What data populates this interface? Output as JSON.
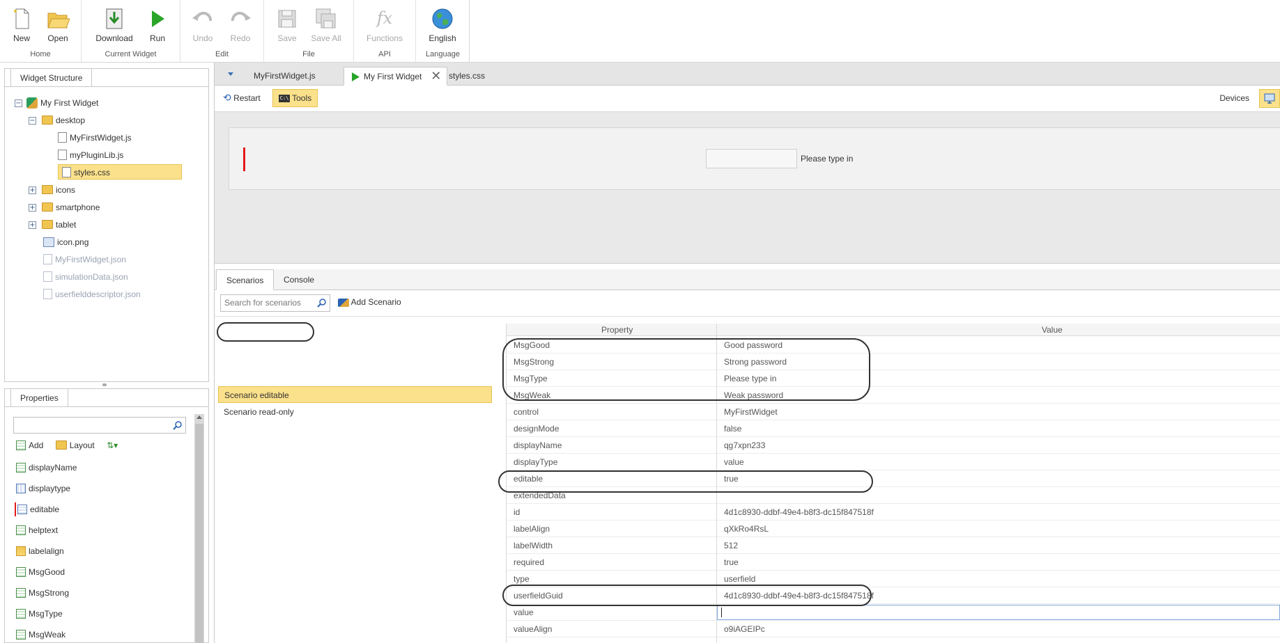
{
  "ribbon": {
    "groups": [
      {
        "name": "Home",
        "buttons": [
          {
            "label": "New"
          },
          {
            "label": "Open"
          }
        ]
      },
      {
        "name": "Current Widget",
        "buttons": [
          {
            "label": "Download"
          },
          {
            "label": "Run"
          }
        ]
      },
      {
        "name": "Edit",
        "buttons": [
          {
            "label": "Undo"
          },
          {
            "label": "Redo"
          }
        ]
      },
      {
        "name": "File",
        "buttons": [
          {
            "label": "Save"
          },
          {
            "label": "Save All"
          }
        ]
      },
      {
        "name": "API",
        "buttons": [
          {
            "label": "Functions"
          }
        ]
      },
      {
        "name": "Language",
        "buttons": [
          {
            "label": "English"
          }
        ]
      }
    ]
  },
  "widget_structure": {
    "tab": "Widget Structure",
    "tree": [
      {
        "label": "My First Widget"
      },
      {
        "label": "desktop"
      },
      {
        "label": "MyFirstWidget.js"
      },
      {
        "label": "myPluginLib.js"
      },
      {
        "label": "styles.css"
      },
      {
        "label": "icons"
      },
      {
        "label": "smartphone"
      },
      {
        "label": "tablet"
      },
      {
        "label": "icon.png"
      },
      {
        "label": "MyFirstWidget.json"
      },
      {
        "label": "simulationData.json"
      },
      {
        "label": "userfielddescriptor.json"
      }
    ]
  },
  "properties": {
    "tab": "Properties",
    "toolbar": {
      "add": "Add",
      "layout": "Layout"
    },
    "items": [
      "displayName",
      "displaytype",
      "editable",
      "helptext",
      "labelalign",
      "MsgGood",
      "MsgStrong",
      "MsgType",
      "MsgWeak"
    ]
  },
  "doc_tabs": {
    "tab1": "MyFirstWidget.js",
    "tab2": "My First Widget",
    "tab3": "styles.css"
  },
  "toolbar2": {
    "restart": "Restart",
    "tools": "Tools",
    "devices": "Devices"
  },
  "preview": {
    "hint": "Please type in"
  },
  "bottom_tabs": {
    "scenarios": "Scenarios",
    "console": "Console"
  },
  "scenarios": {
    "search_placeholder": "Search for scenarios",
    "add": "Add Scenario",
    "items": [
      "Scenario editable",
      "Scenario read-only"
    ]
  },
  "grid": {
    "headers": {
      "property": "Property",
      "value": "Value"
    },
    "rows": [
      {
        "k": "MsgGood",
        "v": "Good password"
      },
      {
        "k": "MsgStrong",
        "v": "Strong password"
      },
      {
        "k": "MsgType",
        "v": "Please type in"
      },
      {
        "k": "MsgWeak",
        "v": "Weak password"
      },
      {
        "k": "control",
        "v": "MyFirstWidget"
      },
      {
        "k": "designMode",
        "v": "false"
      },
      {
        "k": "displayName",
        "v": "qg7xpn233"
      },
      {
        "k": "displayType",
        "v": "value"
      },
      {
        "k": "editable",
        "v": "true"
      },
      {
        "k": "extendedData",
        "v": ""
      },
      {
        "k": "id",
        "v": "4d1c8930-ddbf-49e4-b8f3-dc15f847518f"
      },
      {
        "k": "labelAlign",
        "v": "qXkRo4RsL"
      },
      {
        "k": "labelWidth",
        "v": "512"
      },
      {
        "k": "required",
        "v": "true"
      },
      {
        "k": "type",
        "v": "userfield"
      },
      {
        "k": "userfieldGuid",
        "v": "4d1c8930-ddbf-49e4-b8f3-dc15f847518f"
      },
      {
        "k": "value",
        "v": ""
      },
      {
        "k": "valueAlign",
        "v": "o9iAGEIPc"
      }
    ]
  },
  "colors": {
    "accent": "#fbe18b",
    "run": "#2aa52a",
    "error": "#e21b1b"
  }
}
